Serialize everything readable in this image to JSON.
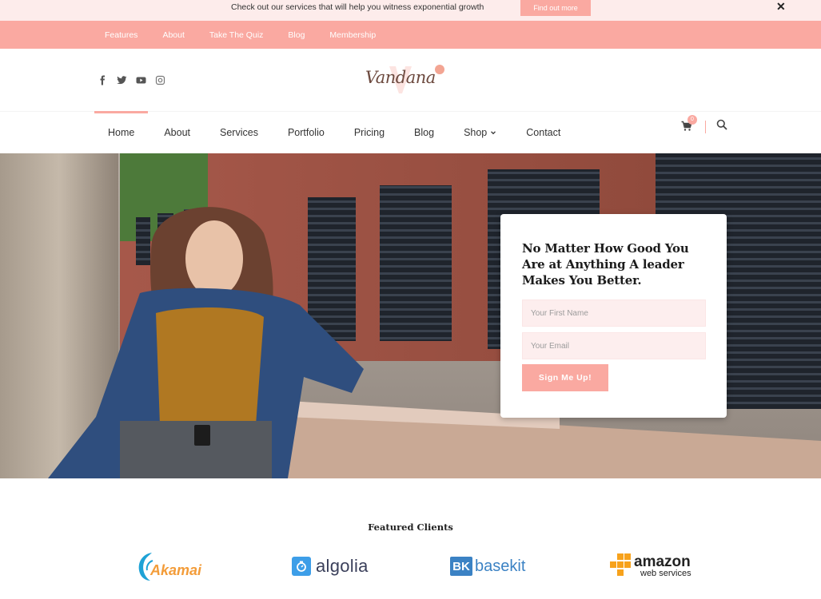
{
  "announcement": {
    "text": "Check out our services that will help you witness exponential growth",
    "button_label": "Find out more",
    "close_label": "✕"
  },
  "top_nav": {
    "items": [
      "Features",
      "About",
      "Take The Quiz",
      "Blog",
      "Membership"
    ]
  },
  "header": {
    "logo_text": "Vandana",
    "social_icons": [
      "facebook-icon",
      "twitter-icon",
      "youtube-icon",
      "instagram-icon"
    ],
    "cart_count": "0"
  },
  "main_nav": {
    "items": [
      {
        "label": "Home",
        "active": true
      },
      {
        "label": "About"
      },
      {
        "label": "Services"
      },
      {
        "label": "Portfolio"
      },
      {
        "label": "Pricing"
      },
      {
        "label": "Blog"
      },
      {
        "label": "Shop",
        "dropdown": true
      },
      {
        "label": "Contact"
      }
    ]
  },
  "signup": {
    "heading_lines": [
      "No Matter How Good You",
      "Are at Anything A leader",
      "Makes You Better."
    ],
    "first_name_placeholder": "Your First Name",
    "email_placeholder": "Your Email",
    "submit_label": "Sign Me Up!"
  },
  "clients": {
    "title": "Featured Clients",
    "logos": [
      {
        "name": "Akamai",
        "text": "Akamai",
        "color": "#f39c39"
      },
      {
        "name": "algolia",
        "text": "algolia",
        "color": "#3a3f5a"
      },
      {
        "name": "basekit",
        "text": "basekit",
        "color": "#3b82c4"
      },
      {
        "name": "amazon",
        "text": "amazon",
        "sub": "web services",
        "color": "#222222"
      }
    ]
  },
  "colors": {
    "accent": "#faa9a1",
    "announcement_bg": "#fdeceb",
    "input_bg": "#fdeeee"
  }
}
